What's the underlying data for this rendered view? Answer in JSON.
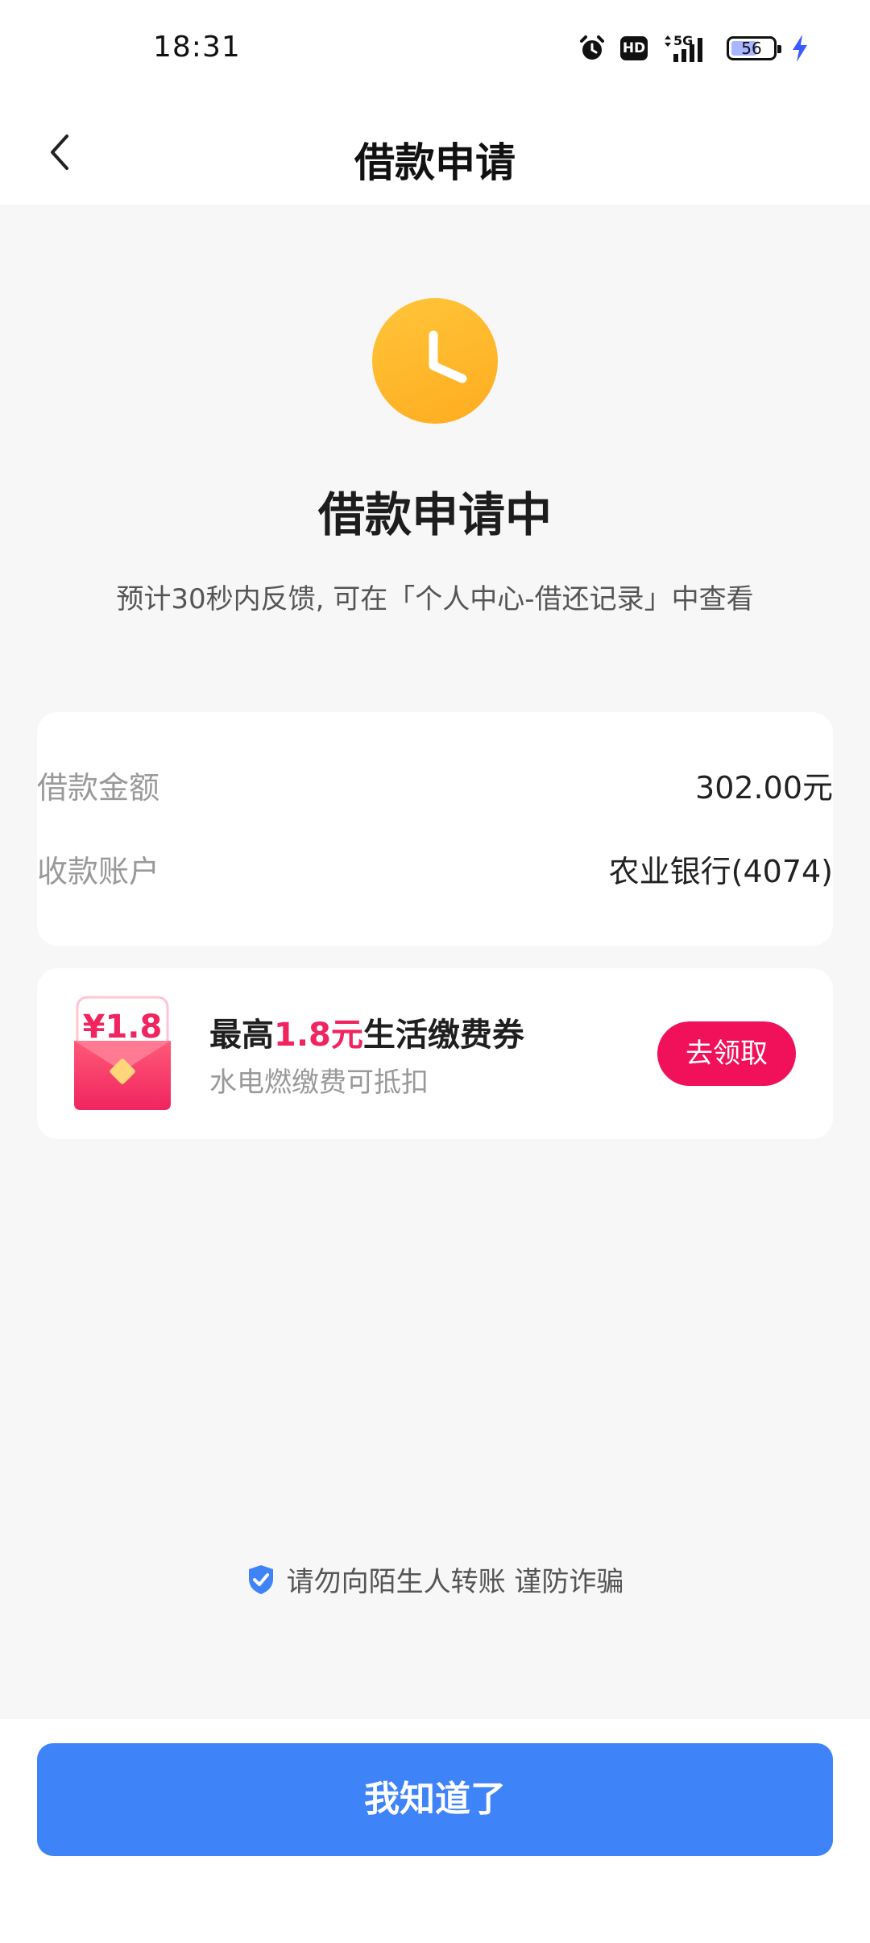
{
  "status_bar": {
    "time": "18:31",
    "icons": [
      "alarm-icon",
      "hd-icon",
      "5g-signal-icon",
      "battery-icon",
      "charging-icon"
    ],
    "hd_label": "HD",
    "network_label": "5G",
    "battery_level": "56"
  },
  "nav": {
    "title": "借款申请",
    "back_icon": "chevron-left-icon"
  },
  "status": {
    "icon": "clock-icon",
    "icon_color": "#ffb829",
    "title": "借款申请中",
    "description": "预计30秒内反馈, 可在「个人中心-借还记录」中查看"
  },
  "info": {
    "amount_label": "借款金额",
    "amount_value": "302.00元",
    "account_label": "收款账户",
    "account_value": "农业银行(4074)"
  },
  "coupon": {
    "badge_value": "¥1.8",
    "title_prefix": "最高",
    "title_highlight": "1.8元",
    "title_suffix": "生活缴费券",
    "subtitle": "水电燃缴费可抵扣",
    "button_label": "去领取",
    "accent_color": "#f0245f"
  },
  "tip": {
    "icon": "shield-check-icon",
    "text": "请勿向陌生人转账 谨防诈骗"
  },
  "footer": {
    "button_label": "我知道了",
    "button_color": "#3f83f8"
  }
}
